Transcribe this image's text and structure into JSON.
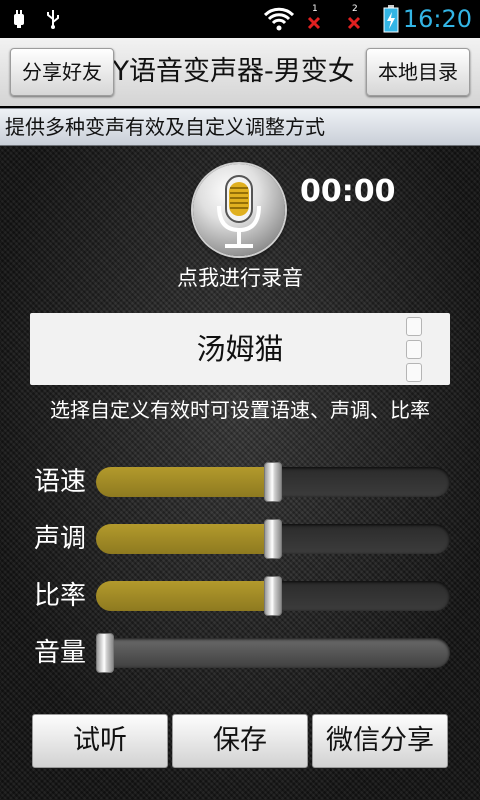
{
  "status_bar": {
    "sim1_label": "1",
    "sim2_label": "2",
    "time": "16:20",
    "time_color": "#33b5e5",
    "icons": [
      "usb-debug-icon",
      "usb-icon",
      "wifi-icon",
      "no-signal-sim1-icon",
      "no-signal-sim2-icon",
      "battery-charging-icon"
    ]
  },
  "title_bar": {
    "title": "YY语音变声器-男变女",
    "share_button": "分享好友",
    "local_dir_button": "本地目录"
  },
  "subtitle": "提供多种变声有效及自定义调整方式",
  "recorder": {
    "timer": "00:00",
    "record_label": "点我进行录音"
  },
  "voice": {
    "selected": "汤姆猫",
    "hint": "选择自定义有效时可设置语速、声调、比率"
  },
  "sliders": [
    {
      "label": "语速",
      "value": 0.5
    },
    {
      "label": "声调",
      "value": 0.5
    },
    {
      "label": "比率",
      "value": 0.5
    },
    {
      "label": "音量",
      "value": 0.0
    }
  ],
  "buttons": {
    "listen": "试听",
    "save": "保存",
    "wechat_share": "微信分享"
  },
  "colors": {
    "slider_fill": "#a08a26",
    "panel_bg": "#1c1c1c"
  }
}
